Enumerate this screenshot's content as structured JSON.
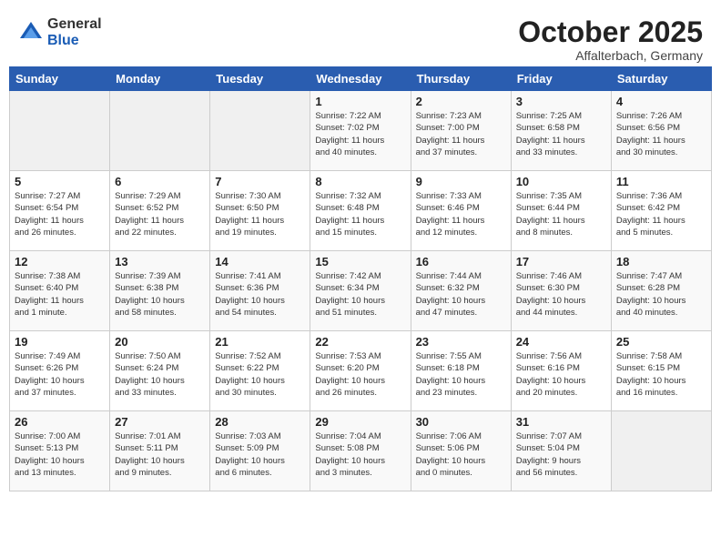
{
  "header": {
    "logo_general": "General",
    "logo_blue": "Blue",
    "month_title": "October 2025",
    "location": "Affalterbach, Germany"
  },
  "weekdays": [
    "Sunday",
    "Monday",
    "Tuesday",
    "Wednesday",
    "Thursday",
    "Friday",
    "Saturday"
  ],
  "weeks": [
    [
      {
        "day": "",
        "info": ""
      },
      {
        "day": "",
        "info": ""
      },
      {
        "day": "",
        "info": ""
      },
      {
        "day": "1",
        "info": "Sunrise: 7:22 AM\nSunset: 7:02 PM\nDaylight: 11 hours\nand 40 minutes."
      },
      {
        "day": "2",
        "info": "Sunrise: 7:23 AM\nSunset: 7:00 PM\nDaylight: 11 hours\nand 37 minutes."
      },
      {
        "day": "3",
        "info": "Sunrise: 7:25 AM\nSunset: 6:58 PM\nDaylight: 11 hours\nand 33 minutes."
      },
      {
        "day": "4",
        "info": "Sunrise: 7:26 AM\nSunset: 6:56 PM\nDaylight: 11 hours\nand 30 minutes."
      }
    ],
    [
      {
        "day": "5",
        "info": "Sunrise: 7:27 AM\nSunset: 6:54 PM\nDaylight: 11 hours\nand 26 minutes."
      },
      {
        "day": "6",
        "info": "Sunrise: 7:29 AM\nSunset: 6:52 PM\nDaylight: 11 hours\nand 22 minutes."
      },
      {
        "day": "7",
        "info": "Sunrise: 7:30 AM\nSunset: 6:50 PM\nDaylight: 11 hours\nand 19 minutes."
      },
      {
        "day": "8",
        "info": "Sunrise: 7:32 AM\nSunset: 6:48 PM\nDaylight: 11 hours\nand 15 minutes."
      },
      {
        "day": "9",
        "info": "Sunrise: 7:33 AM\nSunset: 6:46 PM\nDaylight: 11 hours\nand 12 minutes."
      },
      {
        "day": "10",
        "info": "Sunrise: 7:35 AM\nSunset: 6:44 PM\nDaylight: 11 hours\nand 8 minutes."
      },
      {
        "day": "11",
        "info": "Sunrise: 7:36 AM\nSunset: 6:42 PM\nDaylight: 11 hours\nand 5 minutes."
      }
    ],
    [
      {
        "day": "12",
        "info": "Sunrise: 7:38 AM\nSunset: 6:40 PM\nDaylight: 11 hours\nand 1 minute."
      },
      {
        "day": "13",
        "info": "Sunrise: 7:39 AM\nSunset: 6:38 PM\nDaylight: 10 hours\nand 58 minutes."
      },
      {
        "day": "14",
        "info": "Sunrise: 7:41 AM\nSunset: 6:36 PM\nDaylight: 10 hours\nand 54 minutes."
      },
      {
        "day": "15",
        "info": "Sunrise: 7:42 AM\nSunset: 6:34 PM\nDaylight: 10 hours\nand 51 minutes."
      },
      {
        "day": "16",
        "info": "Sunrise: 7:44 AM\nSunset: 6:32 PM\nDaylight: 10 hours\nand 47 minutes."
      },
      {
        "day": "17",
        "info": "Sunrise: 7:46 AM\nSunset: 6:30 PM\nDaylight: 10 hours\nand 44 minutes."
      },
      {
        "day": "18",
        "info": "Sunrise: 7:47 AM\nSunset: 6:28 PM\nDaylight: 10 hours\nand 40 minutes."
      }
    ],
    [
      {
        "day": "19",
        "info": "Sunrise: 7:49 AM\nSunset: 6:26 PM\nDaylight: 10 hours\nand 37 minutes."
      },
      {
        "day": "20",
        "info": "Sunrise: 7:50 AM\nSunset: 6:24 PM\nDaylight: 10 hours\nand 33 minutes."
      },
      {
        "day": "21",
        "info": "Sunrise: 7:52 AM\nSunset: 6:22 PM\nDaylight: 10 hours\nand 30 minutes."
      },
      {
        "day": "22",
        "info": "Sunrise: 7:53 AM\nSunset: 6:20 PM\nDaylight: 10 hours\nand 26 minutes."
      },
      {
        "day": "23",
        "info": "Sunrise: 7:55 AM\nSunset: 6:18 PM\nDaylight: 10 hours\nand 23 minutes."
      },
      {
        "day": "24",
        "info": "Sunrise: 7:56 AM\nSunset: 6:16 PM\nDaylight: 10 hours\nand 20 minutes."
      },
      {
        "day": "25",
        "info": "Sunrise: 7:58 AM\nSunset: 6:15 PM\nDaylight: 10 hours\nand 16 minutes."
      }
    ],
    [
      {
        "day": "26",
        "info": "Sunrise: 7:00 AM\nSunset: 5:13 PM\nDaylight: 10 hours\nand 13 minutes."
      },
      {
        "day": "27",
        "info": "Sunrise: 7:01 AM\nSunset: 5:11 PM\nDaylight: 10 hours\nand 9 minutes."
      },
      {
        "day": "28",
        "info": "Sunrise: 7:03 AM\nSunset: 5:09 PM\nDaylight: 10 hours\nand 6 minutes."
      },
      {
        "day": "29",
        "info": "Sunrise: 7:04 AM\nSunset: 5:08 PM\nDaylight: 10 hours\nand 3 minutes."
      },
      {
        "day": "30",
        "info": "Sunrise: 7:06 AM\nSunset: 5:06 PM\nDaylight: 10 hours\nand 0 minutes."
      },
      {
        "day": "31",
        "info": "Sunrise: 7:07 AM\nSunset: 5:04 PM\nDaylight: 9 hours\nand 56 minutes."
      },
      {
        "day": "",
        "info": ""
      }
    ]
  ]
}
